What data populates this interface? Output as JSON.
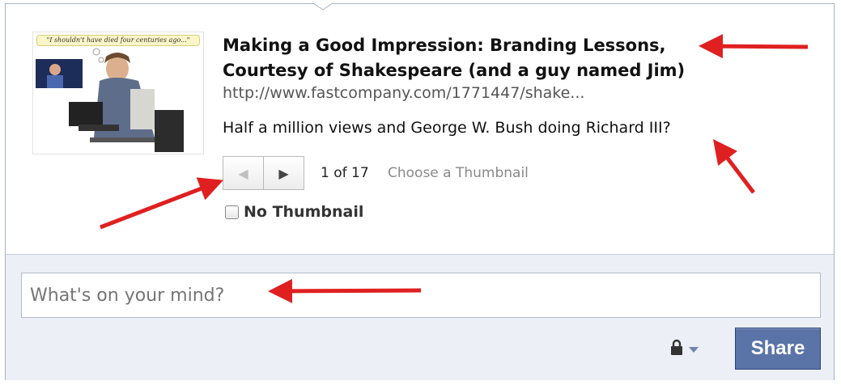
{
  "link_preview": {
    "thumbnail_caption": "\"I shouldn't have died four centuries ago...\"",
    "title_line1": "Making a Good Impression: Branding Lessons,",
    "title_line2": "Courtesy of Shakespeare (and a guy named Jim)",
    "url": "http://www.fastcompany.com/1771447/shake...",
    "summary": "Half a million views and George W. Bush doing Richard III?",
    "pager": {
      "prev_icon": "triangle-left-icon",
      "next_icon": "triangle-right-icon",
      "count": "1 of 17",
      "choose_label": "Choose a Thumbnail"
    },
    "no_thumbnail_label": "No Thumbnail"
  },
  "composer": {
    "placeholder": "What's on your mind?",
    "privacy_icon": "lock-icon",
    "share_label": "Share"
  },
  "annotation_color": "#e02020",
  "colors": {
    "share_bg": "#5b74a8",
    "footer_bg": "#eceff5",
    "border": "#a9b3c4"
  }
}
